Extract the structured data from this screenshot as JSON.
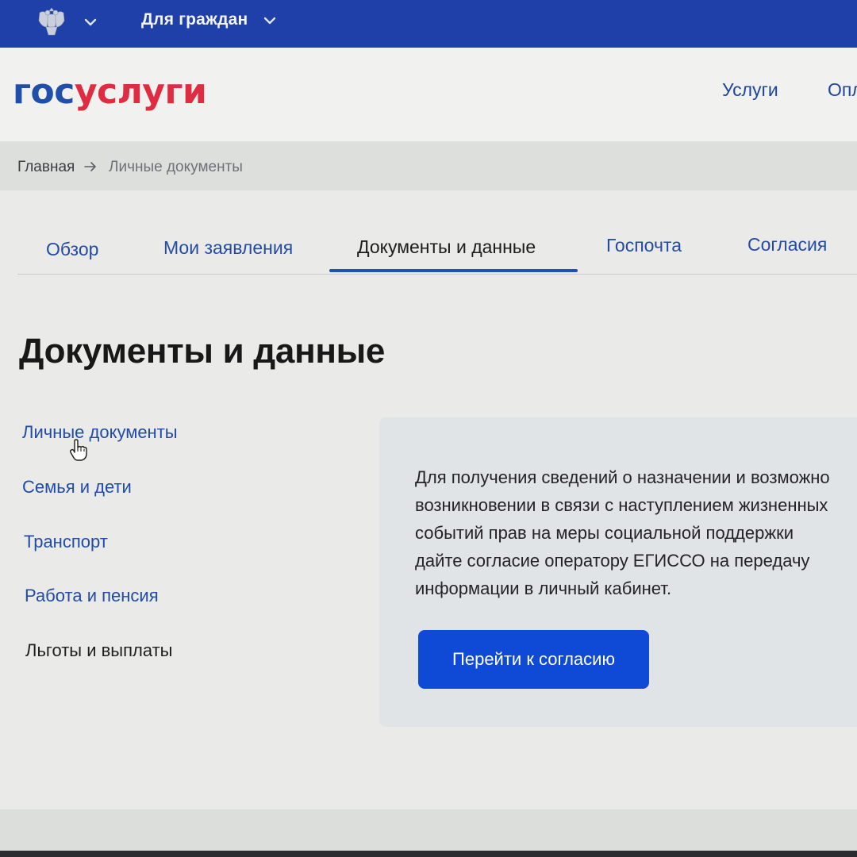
{
  "topbar": {
    "emblem_icon": "coat-of-arms-icon",
    "region_label": "Для граждан",
    "background": "#1f40a8"
  },
  "header": {
    "logo_part1": "гос",
    "logo_part2": "услуги",
    "logo_colors": {
      "part1": "#1f4fa8",
      "part2": "#df2c42"
    },
    "nav": [
      "Услуги",
      "Опл"
    ]
  },
  "breadcrumbs": {
    "home": "Главная",
    "separator_icon": "arrow-right-icon",
    "current": "Личные документы"
  },
  "tabs": [
    {
      "label": "Обзор",
      "active": false
    },
    {
      "label": "Мои заявления",
      "active": false
    },
    {
      "label": "Документы и данные",
      "active": true
    },
    {
      "label": "Госпочта",
      "active": false
    },
    {
      "label": "Согласия",
      "active": false
    }
  ],
  "page_title": "Документы и данные",
  "sidebar": {
    "items": [
      {
        "label": "Личные документы"
      },
      {
        "label": "Семья и дети"
      },
      {
        "label": "Транспорт"
      },
      {
        "label": "Работа и пенсия"
      },
      {
        "label": "Льготы и выплаты"
      }
    ],
    "cursor_icon": "hand-pointer-icon"
  },
  "consent_card": {
    "lines": [
      "Для получения сведений о назначении и возможно",
      "возникновении в связи с наступлением жизненных",
      "событий прав на меры социальной поддержки",
      "дайте согласие оператору ЕГИССО на передачу",
      "информации в личный кабинет."
    ],
    "button_label": "Перейти к согласию",
    "accent": "#0f4ad6"
  }
}
